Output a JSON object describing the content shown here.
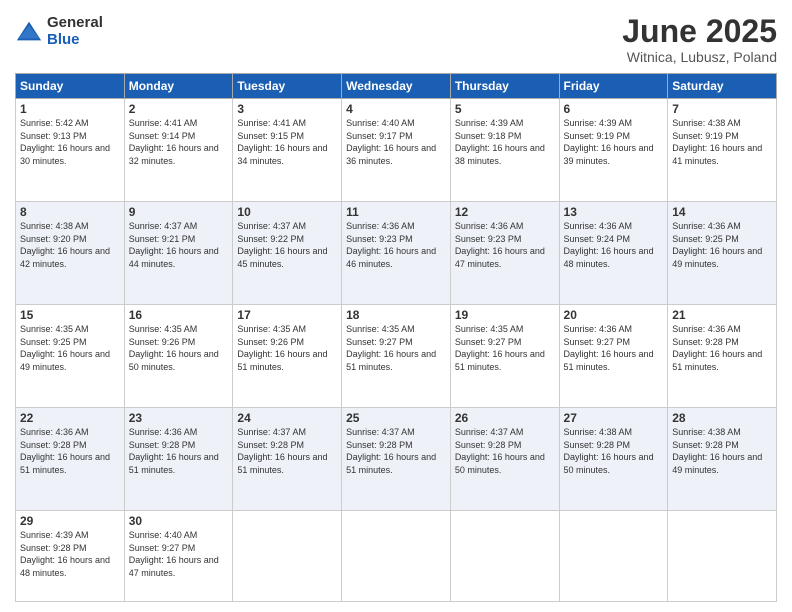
{
  "logo": {
    "general": "General",
    "blue": "Blue"
  },
  "title": "June 2025",
  "location": "Witnica, Lubusz, Poland",
  "weekdays": [
    "Sunday",
    "Monday",
    "Tuesday",
    "Wednesday",
    "Thursday",
    "Friday",
    "Saturday"
  ],
  "weeks": [
    [
      {
        "day": "1",
        "sunrise": "5:42 AM",
        "sunset": "9:13 PM",
        "daylight": "16 hours and 30 minutes."
      },
      {
        "day": "2",
        "sunrise": "4:41 AM",
        "sunset": "9:14 PM",
        "daylight": "16 hours and 32 minutes."
      },
      {
        "day": "3",
        "sunrise": "4:41 AM",
        "sunset": "9:15 PM",
        "daylight": "16 hours and 34 minutes."
      },
      {
        "day": "4",
        "sunrise": "4:40 AM",
        "sunset": "9:17 PM",
        "daylight": "16 hours and 36 minutes."
      },
      {
        "day": "5",
        "sunrise": "4:39 AM",
        "sunset": "9:18 PM",
        "daylight": "16 hours and 38 minutes."
      },
      {
        "day": "6",
        "sunrise": "4:39 AM",
        "sunset": "9:19 PM",
        "daylight": "16 hours and 39 minutes."
      },
      {
        "day": "7",
        "sunrise": "4:38 AM",
        "sunset": "9:19 PM",
        "daylight": "16 hours and 41 minutes."
      }
    ],
    [
      {
        "day": "8",
        "sunrise": "4:38 AM",
        "sunset": "9:20 PM",
        "daylight": "16 hours and 42 minutes."
      },
      {
        "day": "9",
        "sunrise": "4:37 AM",
        "sunset": "9:21 PM",
        "daylight": "16 hours and 44 minutes."
      },
      {
        "day": "10",
        "sunrise": "4:37 AM",
        "sunset": "9:22 PM",
        "daylight": "16 hours and 45 minutes."
      },
      {
        "day": "11",
        "sunrise": "4:36 AM",
        "sunset": "9:23 PM",
        "daylight": "16 hours and 46 minutes."
      },
      {
        "day": "12",
        "sunrise": "4:36 AM",
        "sunset": "9:23 PM",
        "daylight": "16 hours and 47 minutes."
      },
      {
        "day": "13",
        "sunrise": "4:36 AM",
        "sunset": "9:24 PM",
        "daylight": "16 hours and 48 minutes."
      },
      {
        "day": "14",
        "sunrise": "4:36 AM",
        "sunset": "9:25 PM",
        "daylight": "16 hours and 49 minutes."
      }
    ],
    [
      {
        "day": "15",
        "sunrise": "4:35 AM",
        "sunset": "9:25 PM",
        "daylight": "16 hours and 49 minutes."
      },
      {
        "day": "16",
        "sunrise": "4:35 AM",
        "sunset": "9:26 PM",
        "daylight": "16 hours and 50 minutes."
      },
      {
        "day": "17",
        "sunrise": "4:35 AM",
        "sunset": "9:26 PM",
        "daylight": "16 hours and 51 minutes."
      },
      {
        "day": "18",
        "sunrise": "4:35 AM",
        "sunset": "9:27 PM",
        "daylight": "16 hours and 51 minutes."
      },
      {
        "day": "19",
        "sunrise": "4:35 AM",
        "sunset": "9:27 PM",
        "daylight": "16 hours and 51 minutes."
      },
      {
        "day": "20",
        "sunrise": "4:36 AM",
        "sunset": "9:27 PM",
        "daylight": "16 hours and 51 minutes."
      },
      {
        "day": "21",
        "sunrise": "4:36 AM",
        "sunset": "9:28 PM",
        "daylight": "16 hours and 51 minutes."
      }
    ],
    [
      {
        "day": "22",
        "sunrise": "4:36 AM",
        "sunset": "9:28 PM",
        "daylight": "16 hours and 51 minutes."
      },
      {
        "day": "23",
        "sunrise": "4:36 AM",
        "sunset": "9:28 PM",
        "daylight": "16 hours and 51 minutes."
      },
      {
        "day": "24",
        "sunrise": "4:37 AM",
        "sunset": "9:28 PM",
        "daylight": "16 hours and 51 minutes."
      },
      {
        "day": "25",
        "sunrise": "4:37 AM",
        "sunset": "9:28 PM",
        "daylight": "16 hours and 51 minutes."
      },
      {
        "day": "26",
        "sunrise": "4:37 AM",
        "sunset": "9:28 PM",
        "daylight": "16 hours and 50 minutes."
      },
      {
        "day": "27",
        "sunrise": "4:38 AM",
        "sunset": "9:28 PM",
        "daylight": "16 hours and 50 minutes."
      },
      {
        "day": "28",
        "sunrise": "4:38 AM",
        "sunset": "9:28 PM",
        "daylight": "16 hours and 49 minutes."
      }
    ],
    [
      {
        "day": "29",
        "sunrise": "4:39 AM",
        "sunset": "9:28 PM",
        "daylight": "16 hours and 48 minutes."
      },
      {
        "day": "30",
        "sunrise": "4:40 AM",
        "sunset": "9:27 PM",
        "daylight": "16 hours and 47 minutes."
      },
      null,
      null,
      null,
      null,
      null
    ]
  ]
}
